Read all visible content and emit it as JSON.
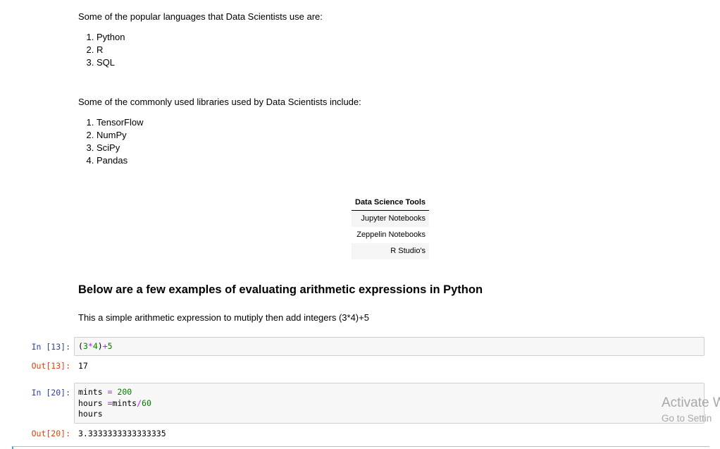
{
  "languages": {
    "intro": "Some of the popular languages that Data Scientists use are:",
    "items": [
      "Python",
      "R",
      "SQL"
    ]
  },
  "libraries": {
    "intro": "Some of the commonly used libraries used by Data Scientists include:",
    "items": [
      "TensorFlow",
      "NumPy",
      "SciPy",
      "Pandas"
    ]
  },
  "tools_table": {
    "header": "Data Science Tools",
    "rows": [
      "Jupyter Notebooks",
      "Zeppelin Notebooks",
      "R Studio's"
    ]
  },
  "arith": {
    "heading": "Below are a few examples of evaluating arithmetic expressions in Python",
    "description": "This a simple arithmetic expression to mutiply then add integers (3*4)+5"
  },
  "cells": [
    {
      "in_prompt": "In [13]:",
      "out_prompt": "Out[13]:",
      "code": {
        "open": "(",
        "a": "3",
        "mul": "*",
        "b": "4",
        "close": ")",
        "plus": "+",
        "c": "5"
      },
      "output": "17"
    },
    {
      "in_prompt": "In [20]:",
      "out_prompt": "Out[20]:",
      "code": {
        "l1_var": "mints",
        "l1_eq": " = ",
        "l1_val": "200",
        "l2_var": "hours",
        "l2_eq": " =",
        "l2_expr": "mints",
        "l2_div": "/",
        "l2_val": "60",
        "l3": "hours"
      },
      "output": "3.3333333333333335"
    }
  ],
  "watermark": {
    "title": "Activate W",
    "subtitle": "Go to Settin"
  }
}
